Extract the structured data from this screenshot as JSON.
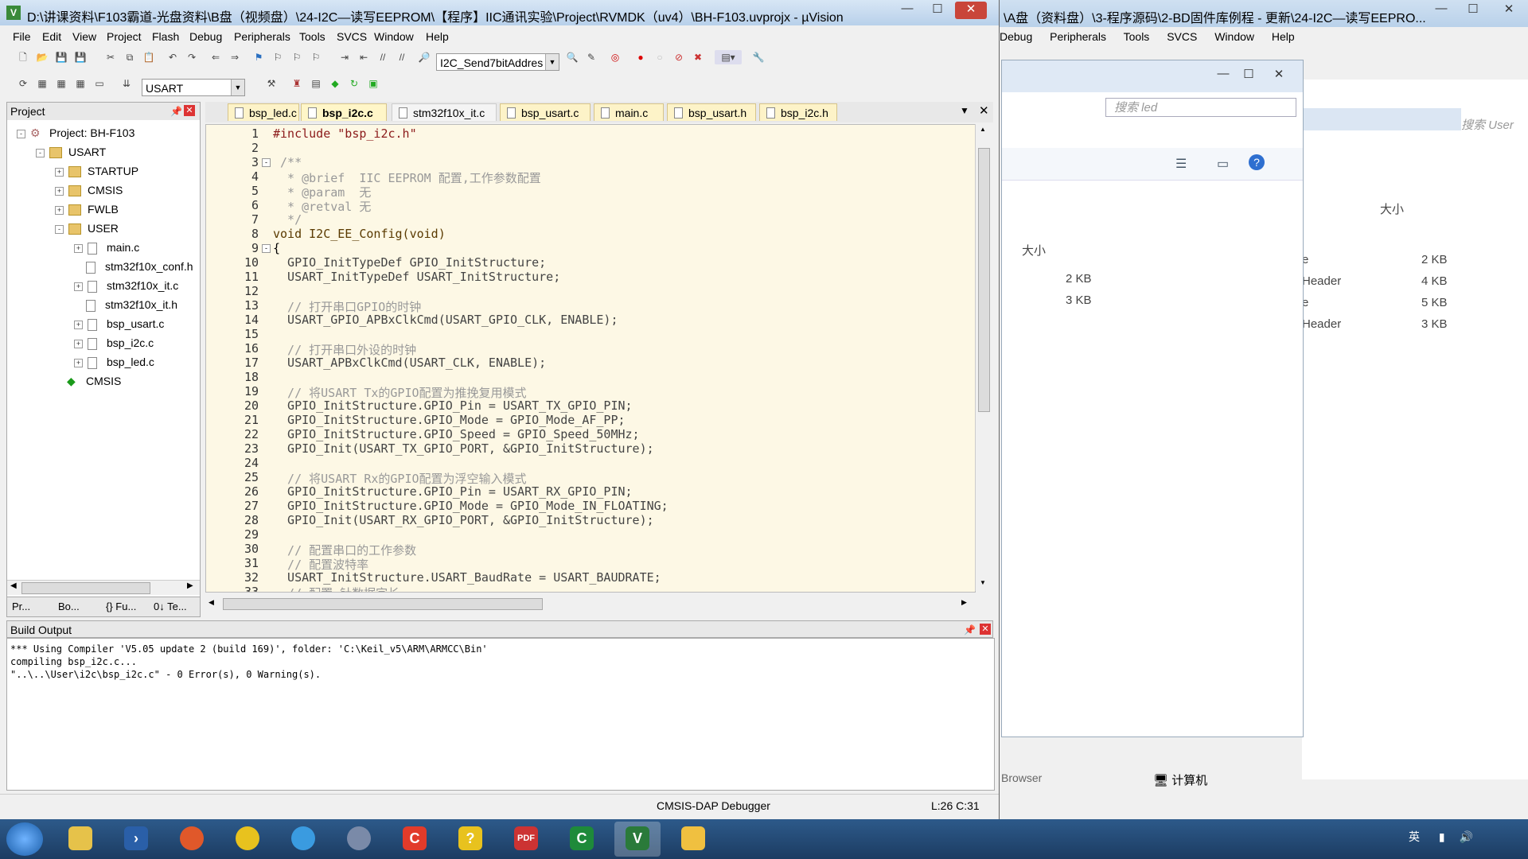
{
  "main_window": {
    "title": "D:\\讲课资料\\F103霸道-光盘资料\\B盘（视频盘）\\24-I2C—读写EEPROM\\【程序】IIC通讯实验\\Project\\RVMDK（uv4）\\BH-F103.uvprojx - µVision",
    "menu": [
      "File",
      "Edit",
      "View",
      "Project",
      "Flash",
      "Debug",
      "Peripherals",
      "Tools",
      "SVCS",
      "Window",
      "Help"
    ],
    "find_combo_value": "I2C_Send7bitAddres",
    "target_combo_value": "USART"
  },
  "project_panel": {
    "title": "Project",
    "tree": [
      {
        "label": "Project: BH-F103",
        "level": 0,
        "type": "project",
        "expander": "-"
      },
      {
        "label": "USART",
        "level": 1,
        "type": "target",
        "expander": "-"
      },
      {
        "label": "STARTUP",
        "level": 2,
        "type": "folder",
        "expander": "+"
      },
      {
        "label": "CMSIS",
        "level": 2,
        "type": "folder",
        "expander": "+"
      },
      {
        "label": "FWLB",
        "level": 2,
        "type": "folder",
        "expander": "+"
      },
      {
        "label": "USER",
        "level": 2,
        "type": "folder",
        "expander": "-"
      },
      {
        "label": "main.c",
        "level": 3,
        "type": "file",
        "expander": "+"
      },
      {
        "label": "stm32f10x_conf.h",
        "level": 3,
        "type": "file",
        "expander": ""
      },
      {
        "label": "stm32f10x_it.c",
        "level": 3,
        "type": "file",
        "expander": "+"
      },
      {
        "label": "stm32f10x_it.h",
        "level": 3,
        "type": "file",
        "expander": ""
      },
      {
        "label": "bsp_usart.c",
        "level": 3,
        "type": "file",
        "expander": "+"
      },
      {
        "label": "bsp_i2c.c",
        "level": 3,
        "type": "file",
        "expander": "+"
      },
      {
        "label": "bsp_led.c",
        "level": 3,
        "type": "file",
        "expander": "+"
      },
      {
        "label": "CMSIS",
        "level": 2,
        "type": "component",
        "expander": ""
      }
    ],
    "bottom_tabs": [
      "Pr...",
      "Bo...",
      "{} Fu...",
      "0↓ Te..."
    ]
  },
  "editor": {
    "tabs": [
      {
        "label": "bsp_led.c",
        "active": false
      },
      {
        "label": "bsp_i2c.c",
        "active": true
      },
      {
        "label": "stm32f10x_it.c",
        "active": false
      },
      {
        "label": "bsp_usart.c",
        "active": false
      },
      {
        "label": "main.c",
        "active": false
      },
      {
        "label": "bsp_usart.h",
        "active": false
      },
      {
        "label": "bsp_i2c.h",
        "active": false
      }
    ],
    "lines": [
      {
        "n": "1",
        "text": "#include \"bsp_i2c.h\"",
        "color": "#8b1a1a"
      },
      {
        "n": "2",
        "text": "",
        "color": "#000"
      },
      {
        "n": "3",
        "text": " /**",
        "color": "#999999",
        "fold": "-"
      },
      {
        "n": "4",
        "text": "  * @brief  IIC EEPROM 配置,工作参数配置",
        "color": "#999999"
      },
      {
        "n": "5",
        "text": "  * @param  无",
        "color": "#999999"
      },
      {
        "n": "6",
        "text": "  * @retval 无",
        "color": "#999999"
      },
      {
        "n": "7",
        "text": "  */",
        "color": "#999999"
      },
      {
        "n": "8",
        "text": "void I2C_EE_Config(void)",
        "color": "#5a3a00"
      },
      {
        "n": "9",
        "text": "{",
        "color": "#000",
        "fold": "-"
      },
      {
        "n": "10",
        "text": "  GPIO_InitTypeDef GPIO_InitStructure;",
        "color": "#444"
      },
      {
        "n": "11",
        "text": "  USART_InitTypeDef USART_InitStructure;",
        "color": "#444"
      },
      {
        "n": "12",
        "text": "",
        "color": "#000"
      },
      {
        "n": "13",
        "text": "  // 打开串口GPIO的时钟",
        "color": "#999999"
      },
      {
        "n": "14",
        "text": "  USART_GPIO_APBxClkCmd(USART_GPIO_CLK, ENABLE);",
        "color": "#444"
      },
      {
        "n": "15",
        "text": "",
        "color": "#000"
      },
      {
        "n": "16",
        "text": "  // 打开串口外设的时钟",
        "color": "#999999"
      },
      {
        "n": "17",
        "text": "  USART_APBxClkCmd(USART_CLK, ENABLE);",
        "color": "#444"
      },
      {
        "n": "18",
        "text": "",
        "color": "#000"
      },
      {
        "n": "19",
        "text": "  // 将USART Tx的GPIO配置为推挽复用模式",
        "color": "#999999"
      },
      {
        "n": "20",
        "text": "  GPIO_InitStructure.GPIO_Pin = USART_TX_GPIO_PIN;",
        "color": "#444"
      },
      {
        "n": "21",
        "text": "  GPIO_InitStructure.GPIO_Mode = GPIO_Mode_AF_PP;",
        "color": "#444"
      },
      {
        "n": "22",
        "text": "  GPIO_InitStructure.GPIO_Speed = GPIO_Speed_50MHz;",
        "color": "#444"
      },
      {
        "n": "23",
        "text": "  GPIO_Init(USART_TX_GPIO_PORT, &GPIO_InitStructure);",
        "color": "#444"
      },
      {
        "n": "24",
        "text": "",
        "color": "#000"
      },
      {
        "n": "25",
        "text": "  // 将USART Rx的GPIO配置为浮空输入模式",
        "color": "#999999"
      },
      {
        "n": "26",
        "text": "  GPIO_InitStructure.GPIO_Pin = USART_RX_GPIO_PIN;",
        "color": "#444"
      },
      {
        "n": "27",
        "text": "  GPIO_InitStructure.GPIO_Mode = GPIO_Mode_IN_FLOATING;",
        "color": "#444"
      },
      {
        "n": "28",
        "text": "  GPIO_Init(USART_RX_GPIO_PORT, &GPIO_InitStructure);",
        "color": "#444"
      },
      {
        "n": "29",
        "text": "",
        "color": "#000"
      },
      {
        "n": "30",
        "text": "  // 配置串口的工作参数",
        "color": "#999999"
      },
      {
        "n": "31",
        "text": "  // 配置波特率",
        "color": "#999999"
      },
      {
        "n": "32",
        "text": "  USART_InitStructure.USART_BaudRate = USART_BAUDRATE;",
        "color": "#444"
      },
      {
        "n": "33",
        "text": "  // 配置 针数据字长",
        "color": "#999999"
      }
    ]
  },
  "build_output": {
    "title": "Build Output",
    "lines": [
      "*** Using Compiler 'V5.05 update 2 (build 169)', folder: 'C:\\Keil_v5\\ARM\\ARMCC\\Bin'",
      "compiling bsp_i2c.c...",
      "\"..\\..\\User\\i2c\\bsp_i2c.c\" - 0 Error(s), 0 Warning(s)."
    ]
  },
  "status_bar": {
    "debugger": "CMSIS-DAP Debugger",
    "position": "L:26 C:31"
  },
  "background_window": {
    "title": "\\A盘（资料盘）\\3-程序源码\\2-BD固件库例程 - 更新\\24-I2C—读写EEPRO...",
    "menu": [
      "Debug",
      "Peripherals",
      "Tools",
      "SVCS",
      "Window",
      "Help"
    ],
    "search_placeholder": "搜索 led",
    "search_placeholder_2": "搜索 User",
    "size_header": "大小",
    "sizes": [
      "2 KB",
      "3 KB"
    ],
    "right_header": "大小",
    "right_rows": [
      {
        "type": "e",
        "size": "2 KB"
      },
      {
        "type": "Header",
        "size": "4 KB"
      },
      {
        "type": "e",
        "size": "5 KB"
      },
      {
        "type": "Header",
        "size": "3 KB"
      }
    ],
    "computer_label": "计算机",
    "browser_label": "Browser"
  },
  "taskbar": {
    "tray_lang": "英"
  }
}
